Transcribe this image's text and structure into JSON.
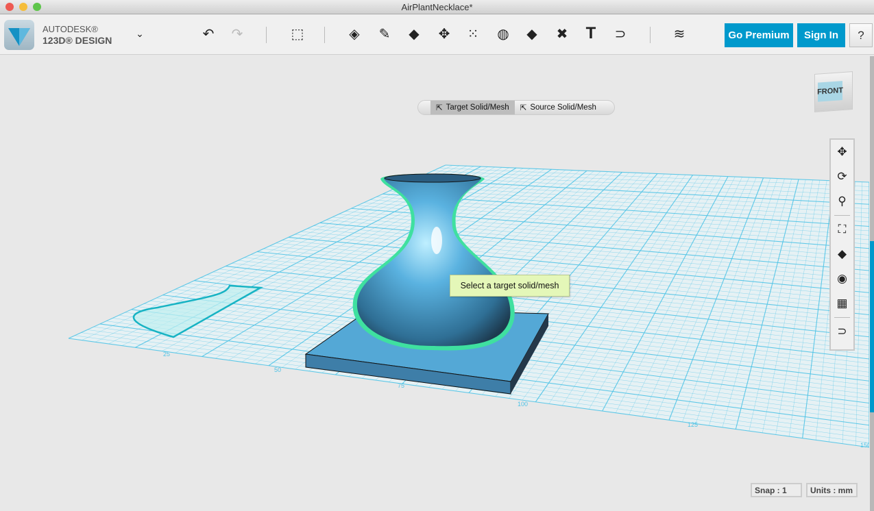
{
  "window": {
    "title": "AirPlantNecklace*"
  },
  "brand": {
    "line1": "AUTODESK®",
    "line2": "123D® DESIGN"
  },
  "toolbar": {
    "menu_icon": "chevron-down-icon",
    "undo": "undo-icon",
    "redo": "redo-icon",
    "tools": [
      "transform-icon",
      "primitives-icon",
      "sketch-icon",
      "construct-icon",
      "modify-icon",
      "pattern-icon",
      "grouping-icon",
      "combine-icon",
      "measure-icon",
      "text-icon",
      "snap-icon",
      "materials-icon"
    ],
    "go_premium": "Go Premium",
    "sign_in": "Sign In",
    "help": "?"
  },
  "selection": {
    "target": "Target Solid/Mesh",
    "source": "Source Solid/Mesh",
    "active": "target"
  },
  "tooltip": "Select a target solid/mesh",
  "viewcube": {
    "face": "FRONT"
  },
  "nav": [
    "pan-icon",
    "orbit-icon",
    "zoom-icon",
    "fit-icon",
    "view-mode-icon",
    "visibility-icon",
    "grid-visibility-icon",
    "material-snap-icon"
  ],
  "grid_labels": [
    "25",
    "50",
    "75",
    "100",
    "125",
    "150"
  ],
  "status": {
    "snap": "Snap : 1",
    "units": "Units : mm"
  },
  "colors": {
    "accent": "#0099cc",
    "grid": "#4fc3e6",
    "solid": "#4aa3d4",
    "highlight": "#3fe0a0"
  }
}
